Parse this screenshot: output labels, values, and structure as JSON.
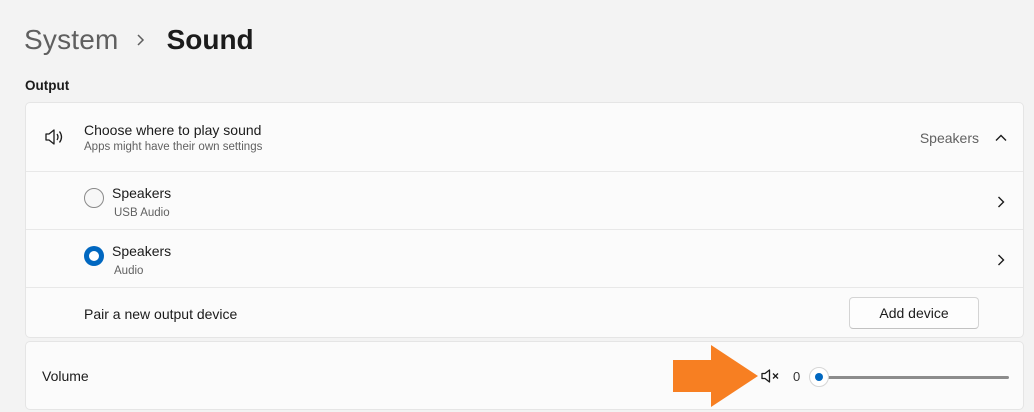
{
  "breadcrumb": {
    "parent": "System",
    "current": "Sound"
  },
  "output": {
    "section_title": "Output",
    "header": {
      "title": "Choose where to play sound",
      "subtitle": "Apps might have their own settings",
      "selected_value": "Speakers",
      "expanded": true
    },
    "devices": [
      {
        "name": "Speakers",
        "sub": "USB Audio",
        "selected": false
      },
      {
        "name": "Speakers",
        "sub": "Audio",
        "selected": true
      }
    ],
    "pair": {
      "label": "Pair a new output device",
      "button_label": "Add device"
    }
  },
  "volume": {
    "label": "Volume",
    "value": "0",
    "muted": true,
    "level": 0
  },
  "annotation": {
    "color": "#f77f22",
    "icon": "arrow-right-icon"
  },
  "colors": {
    "accent": "#0067c0",
    "background": "#f3f3f3",
    "card": "#fbfbfb"
  }
}
